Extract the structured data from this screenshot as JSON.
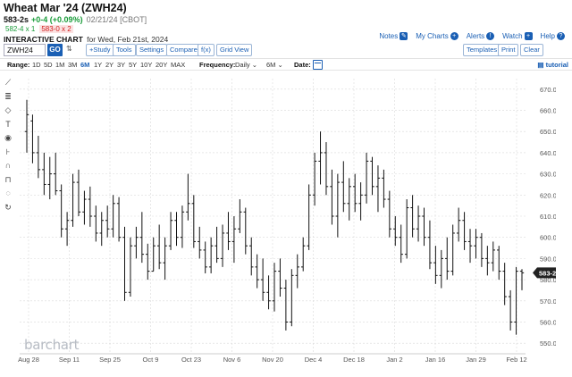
{
  "header": {
    "title": "Wheat Mar '24 (ZWH24)",
    "last": "583-2s",
    "change": "+0-4 (+0.09%)",
    "date": "02/21/24 [CBOT]",
    "bid": "582-4 x 1",
    "ask": "583-0 x 2",
    "interactive_label": "INTERACTIVE CHART",
    "for_date": "for Wed, Feb 21st, 2024"
  },
  "toplinks": {
    "notes": "Notes",
    "my_charts": "My Charts",
    "alerts": "Alerts",
    "watch": "Watch",
    "help": "Help"
  },
  "toolbar": {
    "symbol_value": "ZWH24",
    "go": "GO",
    "study": "+Study",
    "tools": "Tools",
    "settings": "Settings",
    "compare": "Compare",
    "fx": "f(x)",
    "grid_view": "Grid View",
    "templates": "Templates",
    "print": "Print",
    "clear": "Clear"
  },
  "rangebar": {
    "range_label": "Range:",
    "ranges": [
      "1D",
      "5D",
      "1M",
      "3M",
      "6M",
      "1Y",
      "2Y",
      "3Y",
      "5Y",
      "10Y",
      "20Y",
      "MAX"
    ],
    "selected_range": "6M",
    "frequency_label": "Frequency:",
    "frequency": "Daily",
    "period": "6M",
    "date_label": "Date:",
    "tutorial": "tutorial"
  },
  "side_tools": [
    "line-tool-icon",
    "fib-tool-icon",
    "shape-tool-icon",
    "text-tool-icon",
    "eye-icon",
    "measure-tool-icon",
    "magnet-icon",
    "lock-icon",
    "erase-icon",
    "reset-icon"
  ],
  "colors": {
    "accent": "#1a5fb4",
    "up": "#1a9c3a",
    "down": "#d02020",
    "bars": "#111111",
    "grid": "#d9d9d9"
  },
  "watermark": "barchart",
  "chart_data": {
    "type": "ohlc",
    "title": "",
    "xlabel": "",
    "ylabel": "",
    "ylim": [
      545,
      675
    ],
    "yticks": [
      550,
      560,
      570,
      580,
      590,
      600,
      610,
      620,
      630,
      640,
      650,
      660,
      670
    ],
    "ytick_labels": [
      "550.0",
      "560.0",
      "570.0",
      "580.0",
      "590.0",
      "600.0",
      "610.0",
      "620.0",
      "630.0",
      "640.0",
      "650.0",
      "660.0",
      "670.0"
    ],
    "xtick_labels": [
      "Aug 28",
      "Sep 11",
      "Sep 25",
      "Oct 9",
      "Oct 23",
      "Nov 6",
      "Nov 20",
      "Dec 4",
      "Dec 18",
      "Jan 2",
      "Jan 16",
      "Jan 29",
      "Feb 12"
    ],
    "last_price_label": "583-2",
    "last_price": 583.25,
    "grid": true,
    "bars": [
      {
        "o": 650,
        "h": 665,
        "l": 640,
        "c": 658
      },
      {
        "o": 655,
        "h": 658,
        "l": 635,
        "c": 640
      },
      {
        "o": 640,
        "h": 648,
        "l": 628,
        "c": 632
      },
      {
        "o": 632,
        "h": 640,
        "l": 620,
        "c": 625
      },
      {
        "o": 625,
        "h": 638,
        "l": 618,
        "c": 630
      },
      {
        "o": 630,
        "h": 640,
        "l": 620,
        "c": 622
      },
      {
        "o": 622,
        "h": 625,
        "l": 600,
        "c": 604
      },
      {
        "o": 604,
        "h": 612,
        "l": 596,
        "c": 608
      },
      {
        "o": 608,
        "h": 630,
        "l": 605,
        "c": 626
      },
      {
        "o": 626,
        "h": 632,
        "l": 610,
        "c": 612
      },
      {
        "o": 612,
        "h": 622,
        "l": 606,
        "c": 618
      },
      {
        "o": 618,
        "h": 624,
        "l": 605,
        "c": 610
      },
      {
        "o": 610,
        "h": 615,
        "l": 598,
        "c": 602
      },
      {
        "o": 602,
        "h": 612,
        "l": 596,
        "c": 608
      },
      {
        "o": 608,
        "h": 615,
        "l": 600,
        "c": 604
      },
      {
        "o": 604,
        "h": 620,
        "l": 600,
        "c": 616
      },
      {
        "o": 616,
        "h": 619,
        "l": 598,
        "c": 600
      },
      {
        "o": 600,
        "h": 605,
        "l": 570,
        "c": 574
      },
      {
        "o": 574,
        "h": 600,
        "l": 572,
        "c": 596
      },
      {
        "o": 596,
        "h": 605,
        "l": 590,
        "c": 600
      },
      {
        "o": 600,
        "h": 612,
        "l": 588,
        "c": 592
      },
      {
        "o": 592,
        "h": 597,
        "l": 580,
        "c": 584
      },
      {
        "o": 584,
        "h": 600,
        "l": 584,
        "c": 596
      },
      {
        "o": 596,
        "h": 606,
        "l": 585,
        "c": 588
      },
      {
        "o": 588,
        "h": 600,
        "l": 580,
        "c": 596
      },
      {
        "o": 596,
        "h": 612,
        "l": 594,
        "c": 608
      },
      {
        "o": 608,
        "h": 612,
        "l": 596,
        "c": 600
      },
      {
        "o": 600,
        "h": 615,
        "l": 595,
        "c": 612
      },
      {
        "o": 612,
        "h": 630,
        "l": 608,
        "c": 616
      },
      {
        "o": 616,
        "h": 620,
        "l": 595,
        "c": 598
      },
      {
        "o": 598,
        "h": 605,
        "l": 590,
        "c": 594
      },
      {
        "o": 594,
        "h": 598,
        "l": 583,
        "c": 586
      },
      {
        "o": 586,
        "h": 600,
        "l": 583,
        "c": 596
      },
      {
        "o": 596,
        "h": 605,
        "l": 588,
        "c": 590
      },
      {
        "o": 590,
        "h": 606,
        "l": 586,
        "c": 602
      },
      {
        "o": 602,
        "h": 612,
        "l": 594,
        "c": 598
      },
      {
        "o": 598,
        "h": 610,
        "l": 588,
        "c": 604
      },
      {
        "o": 604,
        "h": 618,
        "l": 602,
        "c": 612
      },
      {
        "o": 612,
        "h": 614,
        "l": 592,
        "c": 596
      },
      {
        "o": 596,
        "h": 600,
        "l": 582,
        "c": 586
      },
      {
        "o": 586,
        "h": 592,
        "l": 576,
        "c": 580
      },
      {
        "o": 580,
        "h": 590,
        "l": 570,
        "c": 574
      },
      {
        "o": 574,
        "h": 582,
        "l": 566,
        "c": 570
      },
      {
        "o": 570,
        "h": 588,
        "l": 565,
        "c": 584
      },
      {
        "o": 584,
        "h": 590,
        "l": 572,
        "c": 576
      },
      {
        "o": 576,
        "h": 580,
        "l": 556,
        "c": 560
      },
      {
        "o": 560,
        "h": 585,
        "l": 558,
        "c": 582
      },
      {
        "o": 582,
        "h": 592,
        "l": 576,
        "c": 586
      },
      {
        "o": 586,
        "h": 600,
        "l": 584,
        "c": 596
      },
      {
        "o": 596,
        "h": 625,
        "l": 594,
        "c": 620
      },
      {
        "o": 620,
        "h": 640,
        "l": 615,
        "c": 636
      },
      {
        "o": 636,
        "h": 650,
        "l": 625,
        "c": 640
      },
      {
        "o": 640,
        "h": 645,
        "l": 620,
        "c": 624
      },
      {
        "o": 624,
        "h": 632,
        "l": 606,
        "c": 610
      },
      {
        "o": 610,
        "h": 630,
        "l": 600,
        "c": 626
      },
      {
        "o": 626,
        "h": 636,
        "l": 612,
        "c": 616
      },
      {
        "o": 616,
        "h": 628,
        "l": 608,
        "c": 624
      },
      {
        "o": 624,
        "h": 630,
        "l": 612,
        "c": 616
      },
      {
        "o": 616,
        "h": 626,
        "l": 608,
        "c": 620
      },
      {
        "o": 620,
        "h": 640,
        "l": 616,
        "c": 636
      },
      {
        "o": 636,
        "h": 638,
        "l": 620,
        "c": 624
      },
      {
        "o": 624,
        "h": 634,
        "l": 612,
        "c": 628
      },
      {
        "o": 628,
        "h": 632,
        "l": 614,
        "c": 618
      },
      {
        "o": 618,
        "h": 622,
        "l": 600,
        "c": 604
      },
      {
        "o": 604,
        "h": 610,
        "l": 596,
        "c": 600
      },
      {
        "o": 600,
        "h": 606,
        "l": 588,
        "c": 592
      },
      {
        "o": 592,
        "h": 618,
        "l": 590,
        "c": 614
      },
      {
        "o": 614,
        "h": 620,
        "l": 600,
        "c": 604
      },
      {
        "o": 604,
        "h": 615,
        "l": 598,
        "c": 610
      },
      {
        "o": 610,
        "h": 614,
        "l": 596,
        "c": 600
      },
      {
        "o": 600,
        "h": 608,
        "l": 585,
        "c": 588
      },
      {
        "o": 588,
        "h": 596,
        "l": 578,
        "c": 582
      },
      {
        "o": 582,
        "h": 594,
        "l": 576,
        "c": 590
      },
      {
        "o": 590,
        "h": 600,
        "l": 580,
        "c": 584
      },
      {
        "o": 584,
        "h": 606,
        "l": 582,
        "c": 602
      },
      {
        "o": 602,
        "h": 614,
        "l": 598,
        "c": 608
      },
      {
        "o": 608,
        "h": 612,
        "l": 594,
        "c": 598
      },
      {
        "o": 598,
        "h": 604,
        "l": 588,
        "c": 596
      },
      {
        "o": 596,
        "h": 604,
        "l": 590,
        "c": 600
      },
      {
        "o": 600,
        "h": 602,
        "l": 586,
        "c": 590
      },
      {
        "o": 590,
        "h": 596,
        "l": 582,
        "c": 588
      },
      {
        "o": 588,
        "h": 598,
        "l": 584,
        "c": 594
      },
      {
        "o": 594,
        "h": 596,
        "l": 580,
        "c": 584
      },
      {
        "o": 584,
        "h": 588,
        "l": 568,
        "c": 572
      },
      {
        "o": 572,
        "h": 575,
        "l": 556,
        "c": 560
      },
      {
        "o": 560,
        "h": 586,
        "l": 554,
        "c": 584
      },
      {
        "o": 584,
        "h": 585,
        "l": 575,
        "c": 583.25
      }
    ]
  }
}
